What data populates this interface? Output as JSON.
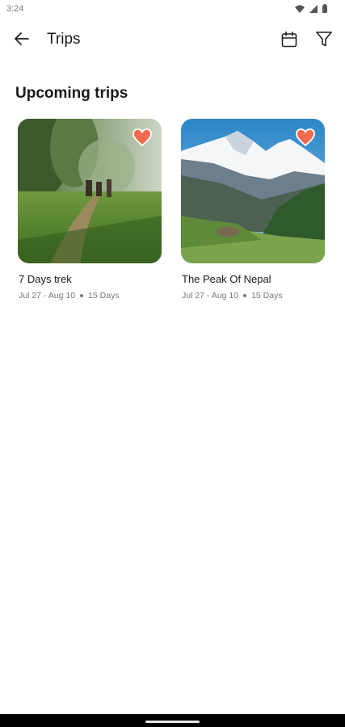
{
  "status_bar": {
    "time": "3:24"
  },
  "app_bar": {
    "title": "Trips",
    "back_icon": "arrow-back-icon",
    "calendar_icon": "calendar-icon",
    "filter_icon": "filter-icon"
  },
  "section": {
    "title": "Upcoming trips"
  },
  "trips": [
    {
      "name": "7 Days trek",
      "dates": "Jul 27 - Aug 10",
      "duration": "15 Days",
      "favorite": true
    },
    {
      "name": "The Peak Of Nepal",
      "dates": "Jul 27 - Aug 10",
      "duration": "15 Days",
      "favorite": true
    }
  ],
  "colors": {
    "heart": "#f26b4f",
    "accent_text": "#1a1a1a",
    "meta_text": "#777777"
  }
}
